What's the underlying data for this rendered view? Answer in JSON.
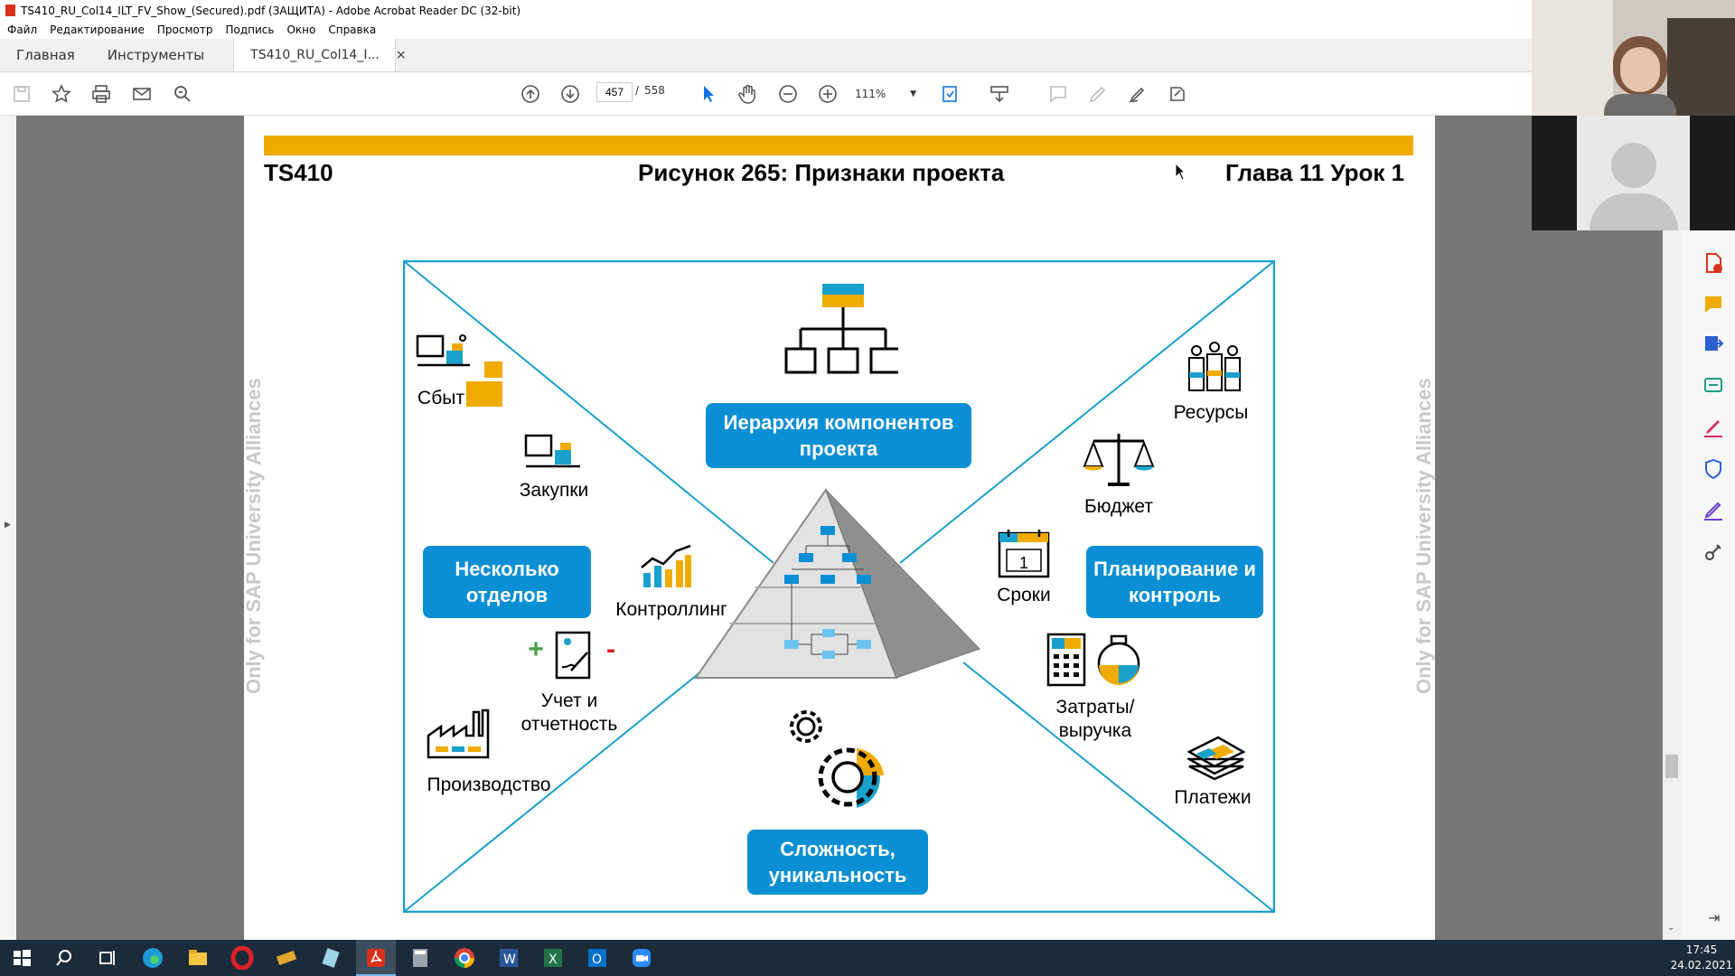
{
  "window": {
    "title": "TS410_RU_Col14_ILT_FV_Show_(Secured).pdf (ЗАЩИТА) - Adobe Acrobat Reader DC (32-bit)"
  },
  "menu": [
    "Файл",
    "Редактирование",
    "Просмотр",
    "Подпись",
    "Окно",
    "Справка"
  ],
  "tabs": {
    "home": "Главная",
    "tools": "Инструменты",
    "document": "TS410_RU_Col14_I...",
    "close": "×"
  },
  "toolbar": {
    "current_page": "457",
    "separator": "/",
    "total_pages": "558",
    "zoom": "111%"
  },
  "page": {
    "left_header": "TS410",
    "center_header": "Рисунок 265: Признаки проекта",
    "right_header": "Глава 11 Урок 1",
    "watermark": "Only for SAP University Alliances",
    "accent_color": "#f0ab00",
    "box_color": "#0a8fd4"
  },
  "figure": {
    "boxes": {
      "top": "Иерархия компонентов проекта",
      "left": "Несколько отделов",
      "right": "Планирование и контроль",
      "bottom": "Сложность, уникальность"
    },
    "labels": {
      "sales": "Сбыт",
      "purchasing": "Закупки",
      "controlling": "Контроллинг",
      "accounting_1": "Учет и",
      "accounting_2": "отчетность",
      "production": "Производство",
      "resources": "Ресурсы",
      "budget": "Бюджет",
      "dates": "Сроки",
      "costs_1": "Затраты/",
      "costs_2": "выручка",
      "payments": "Платежи"
    },
    "plus": "+",
    "minus": "-",
    "calendar_day": "1"
  },
  "taskbar": {
    "time": "17:45",
    "date": "24.02.2021"
  }
}
